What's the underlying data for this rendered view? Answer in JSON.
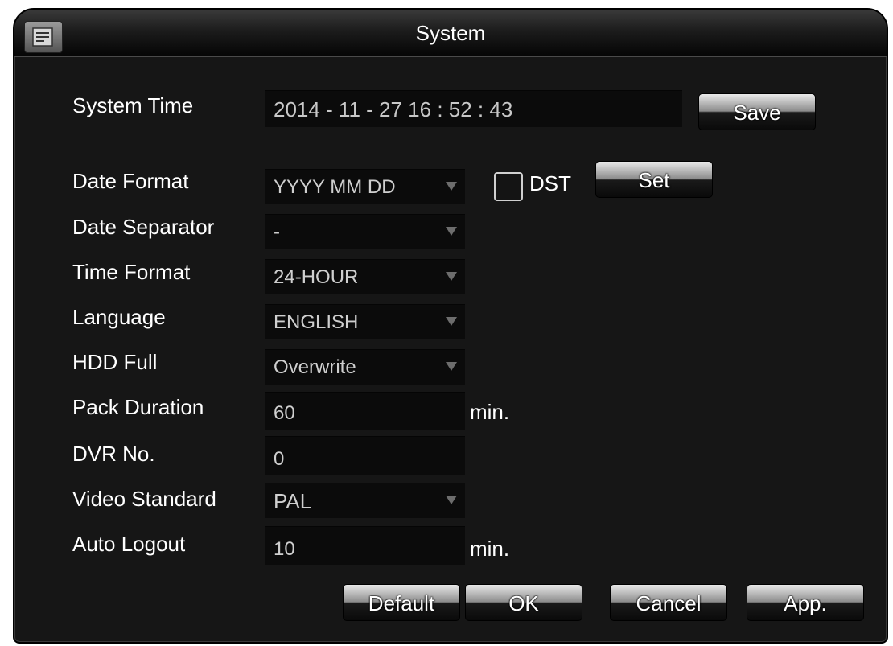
{
  "window": {
    "title": "System",
    "icon": "settings-app-icon"
  },
  "system_time": {
    "label": "System Time",
    "value": "2014  - 11 - 27   16 : 52 : 43",
    "save_label": "Save"
  },
  "date_format": {
    "label": "Date Format",
    "value": "YYYY MM DD",
    "dst_label": "DST",
    "dst_checked": false,
    "set_label": "Set"
  },
  "date_separator": {
    "label": "Date Separator",
    "value": "-"
  },
  "time_format": {
    "label": "Time Format",
    "value": "24-HOUR"
  },
  "language": {
    "label": "Language",
    "value": "ENGLISH"
  },
  "hdd_full": {
    "label": "HDD Full",
    "value": "Overwrite"
  },
  "pack_duration": {
    "label": "Pack Duration",
    "value": "60",
    "unit": "min."
  },
  "dvr_no": {
    "label": "DVR No.",
    "value": "0"
  },
  "video_standard": {
    "label": "Video Standard",
    "value": "PAL"
  },
  "auto_logout": {
    "label": "Auto Logout",
    "value": "10",
    "unit": "min."
  },
  "footer": {
    "default_label": "Default",
    "ok_label": "OK",
    "cancel_label": "Cancel",
    "apply_label": "App."
  },
  "colors": {
    "background": "#161616",
    "field": "#0b0b0b",
    "text": "#ffffff"
  }
}
